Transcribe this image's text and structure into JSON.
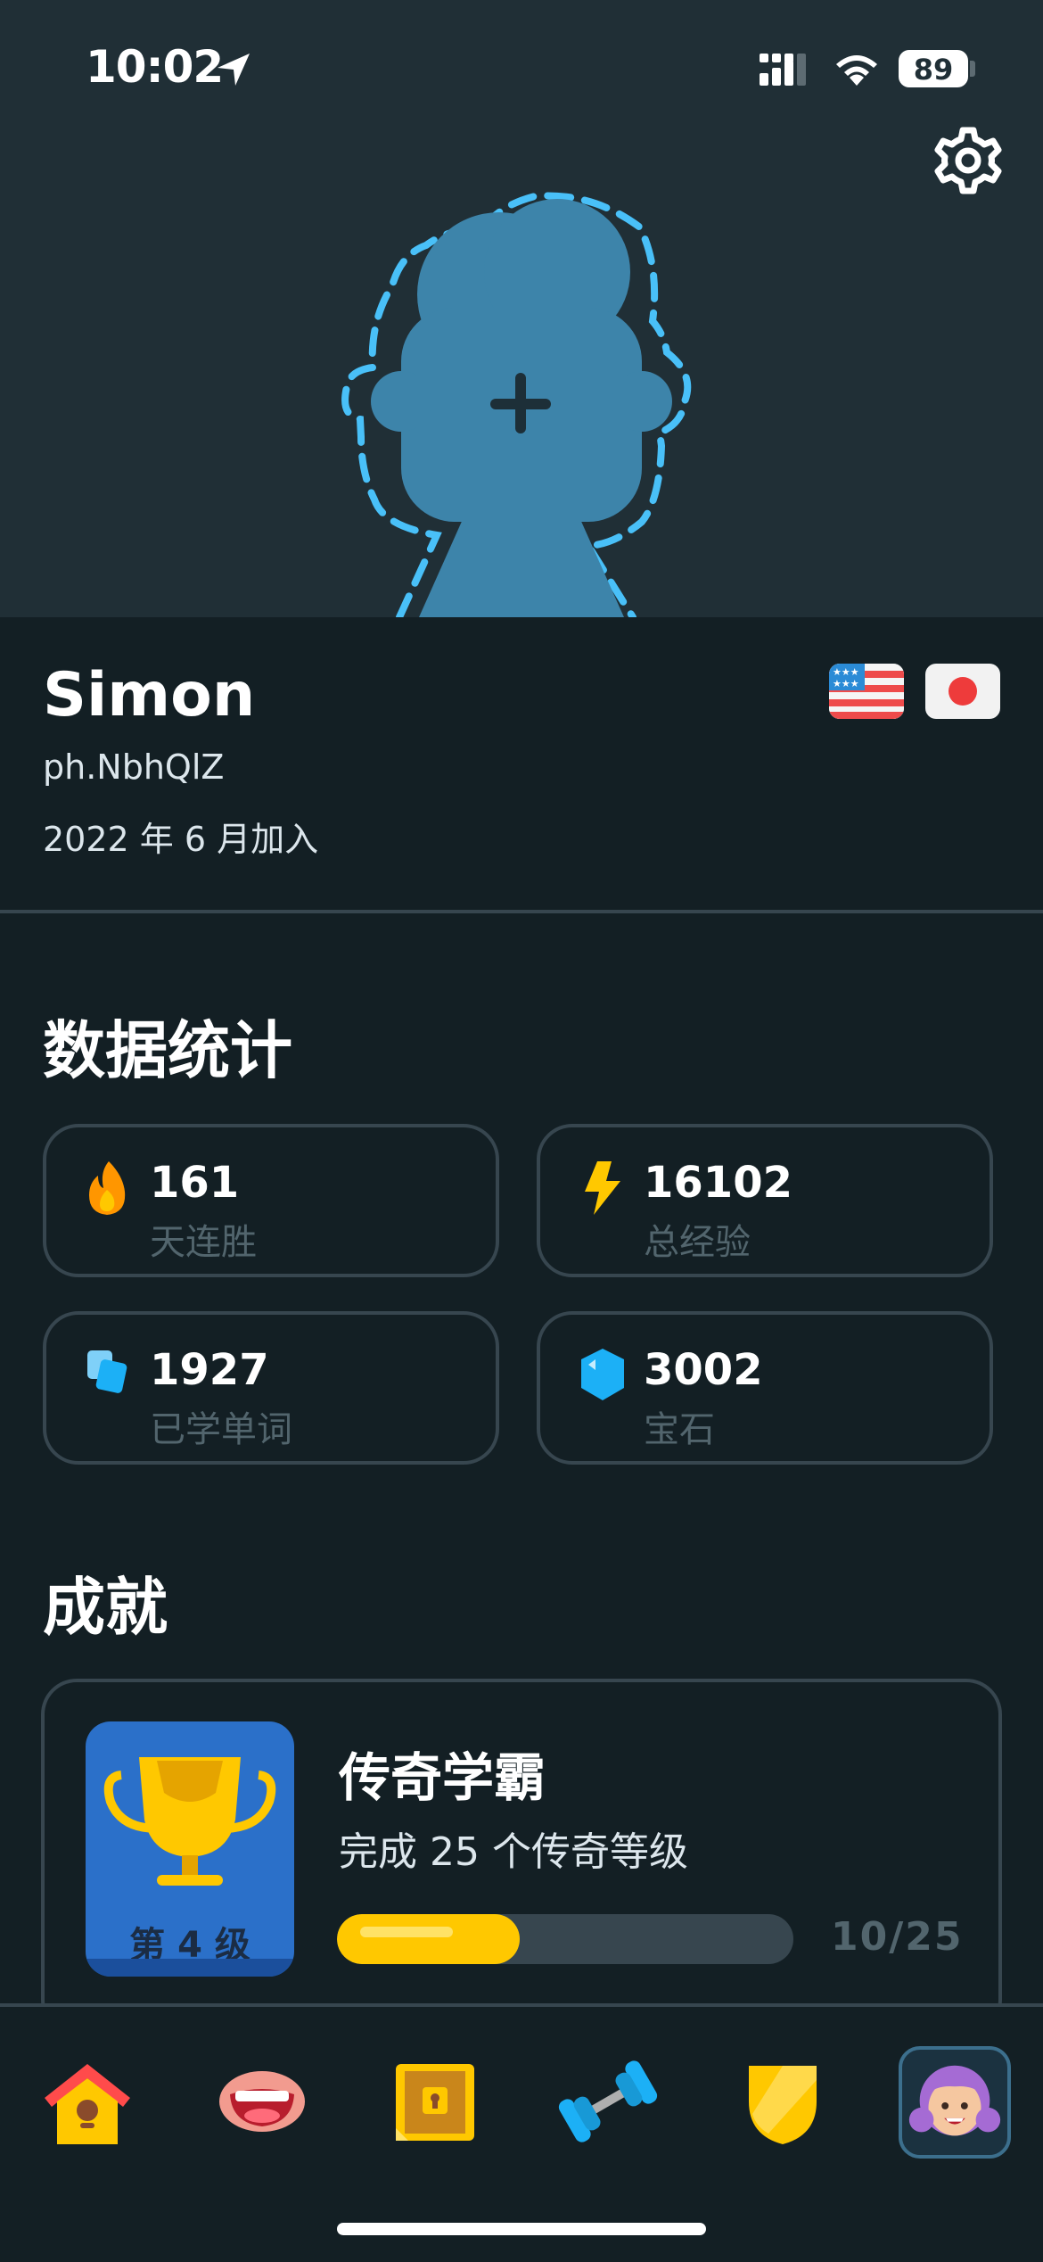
{
  "status_bar": {
    "time": "10:02",
    "battery": "89",
    "icons": [
      "location-arrow-icon",
      "cellular-signal-icon",
      "wifi-icon",
      "battery-icon"
    ]
  },
  "header": {
    "settings_icon": "gear-icon",
    "avatar_placeholder_icon": "add-avatar-icon"
  },
  "profile": {
    "name": "Simon",
    "username": "ph.NbhQlZ",
    "joined": "2022 年 6 月加入",
    "course_flags": [
      "us-flag-icon",
      "japan-flag-icon"
    ]
  },
  "stats": {
    "title": "数据统计",
    "cards": [
      {
        "icon": "flame-icon",
        "value": "161",
        "label": "天连胜"
      },
      {
        "icon": "lightning-icon",
        "value": "16102",
        "label": "总经验"
      },
      {
        "icon": "cards-icon",
        "value": "1927",
        "label": "已学单词"
      },
      {
        "icon": "gem-icon",
        "value": "3002",
        "label": "宝石"
      }
    ]
  },
  "achievements": {
    "title": "成就",
    "items": [
      {
        "icon": "trophy-icon",
        "level": "第 4 级",
        "title": "传奇学霸",
        "description": "完成 25 个传奇等级",
        "progress_text": "10/25",
        "progress": 0.4
      }
    ]
  },
  "tab_bar": {
    "tabs": [
      {
        "name": "home",
        "icon": "home-icon"
      },
      {
        "name": "speak",
        "icon": "mouth-icon"
      },
      {
        "name": "chest",
        "icon": "treasure-chest-icon"
      },
      {
        "name": "practice",
        "icon": "dumbbell-icon"
      },
      {
        "name": "leagues",
        "icon": "shield-icon"
      },
      {
        "name": "profile",
        "icon": "avatar-icon",
        "selected": true
      }
    ]
  },
  "colors": {
    "background": "#131f24",
    "header": "#202f36",
    "card_border": "#37464f",
    "accent_blue": "#1cb0f6",
    "progress_yellow": "#ffc800",
    "muted_text": "#52656d"
  }
}
